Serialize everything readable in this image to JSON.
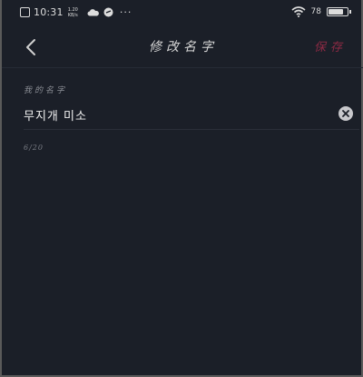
{
  "status_bar": {
    "time": "10:31",
    "net_speed_value": "1.20",
    "net_speed_unit": "KB/s",
    "more_dots": "···",
    "battery_text": "78",
    "battery_level": 0.78
  },
  "header": {
    "title": "修改名字",
    "save_label": "保存",
    "back_icon": "chevron-left-icon"
  },
  "form": {
    "field_label": "我的名字",
    "name_value": "무지개 미소",
    "clear_icon": "clear-circle-icon",
    "char_counter": "6/20"
  },
  "colors": {
    "background": "#1b1f28",
    "accent_save": "#8c2a44",
    "divider": "#2a2f39"
  }
}
